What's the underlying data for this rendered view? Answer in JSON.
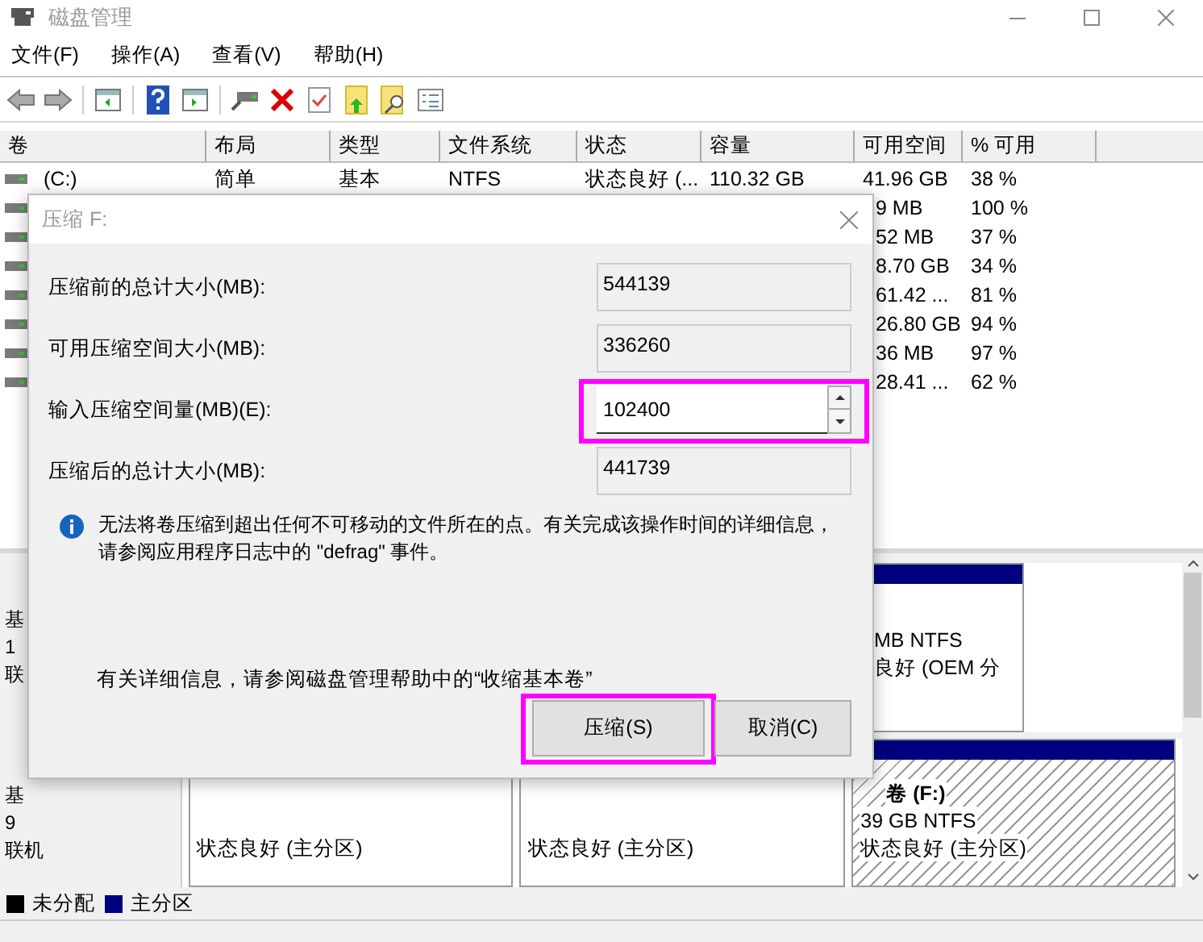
{
  "window": {
    "title": "磁盘管理"
  },
  "menu": [
    "文件(F)",
    "操作(A)",
    "查看(V)",
    "帮助(H)"
  ],
  "volume_table": {
    "columns": [
      "卷",
      "布局",
      "类型",
      "文件系统",
      "状态",
      "容量",
      "可用空间",
      "% 可用"
    ],
    "rows": [
      {
        "volume": "(C:)",
        "layout": "简单",
        "type": "基本",
        "file_system": "NTFS",
        "status": "状态良好 (...",
        "capacity": "110.32 GB",
        "free_space": "41.96 GB",
        "percent_free": "38 %"
      },
      {
        "free_space": "9 MB",
        "percent_free": "100 %"
      },
      {
        "free_space": "52 MB",
        "percent_free": "37 %"
      },
      {
        "free_space": "8.70 GB",
        "percent_free": "34 %"
      },
      {
        "free_space": "61.42 ...",
        "percent_free": "81 %"
      },
      {
        "free_space": "26.80 GB",
        "percent_free": "94 %"
      },
      {
        "free_space": "36 MB",
        "percent_free": "97 %"
      },
      {
        "free_space": "28.41 ...",
        "percent_free": "62 %"
      }
    ]
  },
  "disks": [
    {
      "label_lines": [
        "基",
        "1",
        "联"
      ],
      "partitions": [
        {
          "kind": "primary",
          "lines": [
            "MB NTFS",
            "良好 (OEM 分"
          ]
        }
      ]
    },
    {
      "label_lines": [
        "基",
        "9",
        "联机"
      ],
      "partitions": [
        {
          "kind": "primary",
          "lines": [
            "状态良好 (主分区)"
          ]
        },
        {
          "kind": "primary",
          "lines": [
            "状态良好 (主分区)"
          ]
        },
        {
          "kind": "selected",
          "lines": [
            "卷 (F:)",
            "39 GB NTFS",
            "状态良好 (主分区)"
          ]
        }
      ]
    }
  ],
  "legend": [
    {
      "label": "未分配",
      "color": "#000000"
    },
    {
      "label": "主分区",
      "color": "#000080"
    }
  ],
  "dialog": {
    "title": "压缩 F:",
    "fields": [
      {
        "label": "压缩前的总计大小(MB):",
        "value": "544139",
        "kind": "readonly",
        "highlighted": false
      },
      {
        "label": "可用压缩空间大小(MB):",
        "value": "336260",
        "kind": "readonly",
        "highlighted": false
      },
      {
        "label": "输入压缩空间量(MB)(E):",
        "value": "102400",
        "kind": "spin",
        "highlighted": true
      },
      {
        "label": "压缩后的总计大小(MB):",
        "value": "441739",
        "kind": "readonly",
        "highlighted": false
      }
    ],
    "info": "无法将卷压缩到超出任何不可移动的文件所在的点。有关完成该操作时间的详细信息，请参阅应用程序日志中的 \"defrag\" 事件。",
    "help": "有关详细信息，请参阅磁盘管理帮助中的“收缩基本卷”",
    "buttons": [
      {
        "label": "压缩(S)",
        "highlighted": true
      },
      {
        "label": "取消(C)",
        "highlighted": false
      }
    ]
  }
}
